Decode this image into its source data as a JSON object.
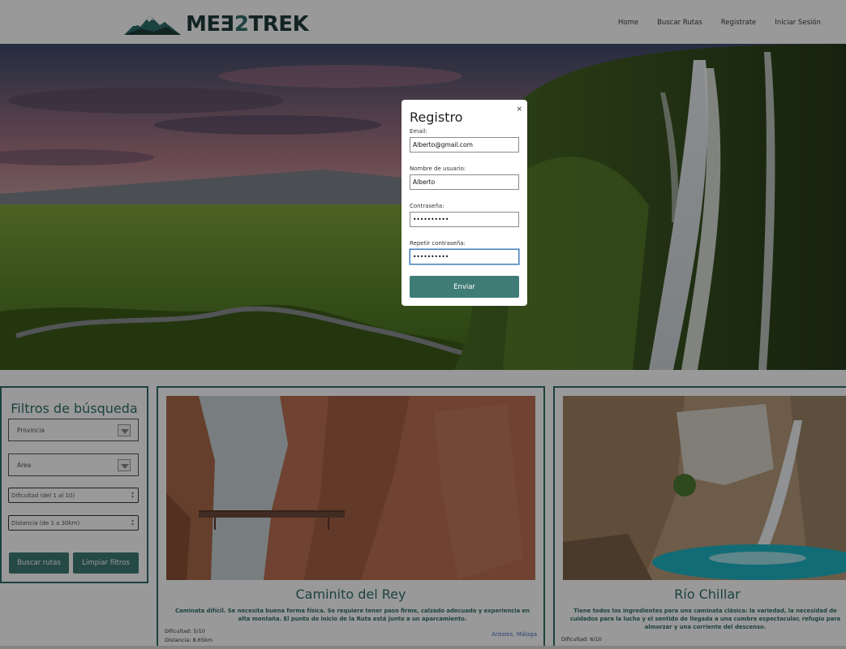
{
  "header": {
    "logo_text_a": "ME",
    "logo_text_b": "E",
    "logo_text_two": "2",
    "logo_text_c": "TREK",
    "nav": [
      "Home",
      "Buscar Rutas",
      "Registrate",
      "Iniciar Sesión"
    ]
  },
  "modal": {
    "title": "Registro",
    "close": "×",
    "email_label": "Email:",
    "email_value": "Alberto@gmail.com",
    "username_label": "Nombre de usuario:",
    "username_value": "Alberto",
    "password_label": "Contraseña:",
    "password_value": "••••••••••",
    "repeat_label": "Repetir contraseña:",
    "repeat_value": "••••••••••",
    "submit": "Enviar"
  },
  "filters": {
    "title": "Filtros de búsqueda",
    "province": "Provincia",
    "area": "Área",
    "difficulty_placeholder": "Dificultad (del 1 al 10)",
    "distance_placeholder": "Distancia (de 1 a 30km)",
    "search_button": "Buscar rutas",
    "clear_button": "Limpiar filtros"
  },
  "cards": [
    {
      "title": "Caminito del Rey",
      "description": "Caminata difícil. Se necesita buena forma física. Se requiere tener paso firme, calzado adecuado y experiencia en alta montaña. El punto de inicio de la Ruta está junto a un aparcamiento.",
      "difficulty": "Dificultad: 5/10",
      "distance": "Distancia: 8,65km",
      "location": "Ardales, Málaga"
    },
    {
      "title": "Río Chillar",
      "description": "Tiene todos los ingredientes para una caminata clásica: la variedad, la necesidad de cuidados para la lucha y el sentido de llegada a una cumbre espectacular, refugio para almorzar y una corriente del descenso.",
      "difficulty": "Dificultad: 6/10"
    }
  ],
  "colors": {
    "accent": "#2f6f69",
    "button": "#3f7c76",
    "link": "#4a6fc8"
  }
}
